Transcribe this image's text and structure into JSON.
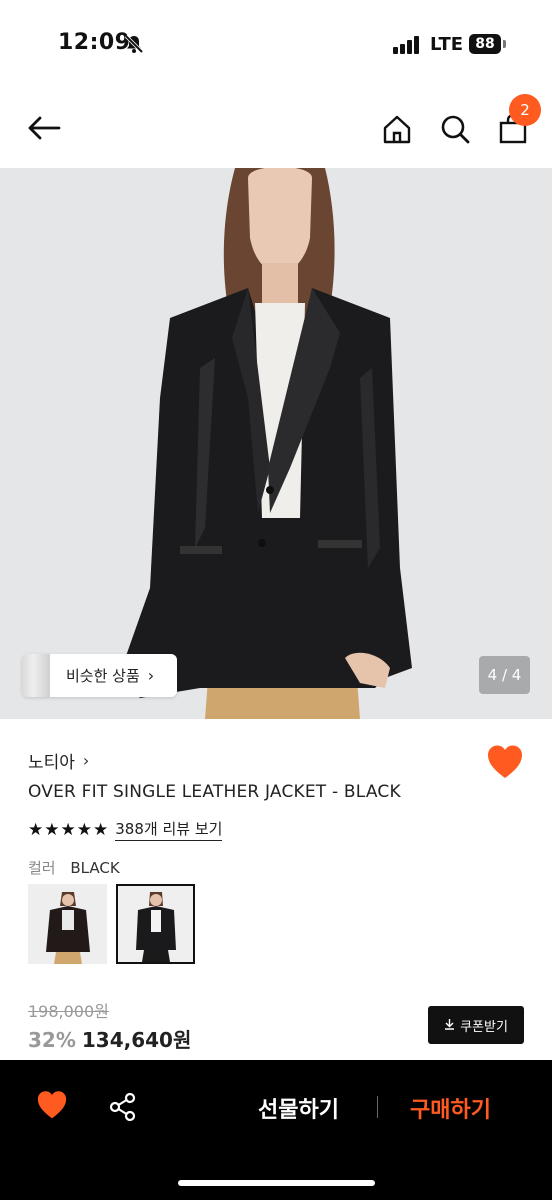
{
  "status_bar": {
    "time": "12:09",
    "network": "LTE",
    "battery": "88"
  },
  "nav": {
    "cart_count": "2"
  },
  "hero": {
    "similar_label": "비슷한 상품",
    "page_indicator": "4 / 4"
  },
  "product": {
    "brand": "노티아",
    "title": "OVER FIT SINGLE LEATHER JACKET - BLACK",
    "rating_stars": 5,
    "review_link": "388개 리뷰 보기",
    "color_label": "컬러",
    "color_value": "BLACK",
    "original_price": "198,000원",
    "discount": "32%",
    "price": "134,640원",
    "coupon_label": "쿠폰받기"
  },
  "bottom_bar": {
    "gift_label": "선물하기",
    "buy_label": "구매하기"
  },
  "colors": {
    "accent": "#ff5a1f",
    "text": "#222222",
    "muted": "#999999"
  },
  "icons": [
    "bell-off-icon",
    "signal-icon",
    "battery-icon",
    "back-arrow-icon",
    "home-icon",
    "search-icon",
    "shopping-bag-icon",
    "chevron-right-icon",
    "heart-icon",
    "star-icon",
    "download-icon",
    "share-icon"
  ]
}
